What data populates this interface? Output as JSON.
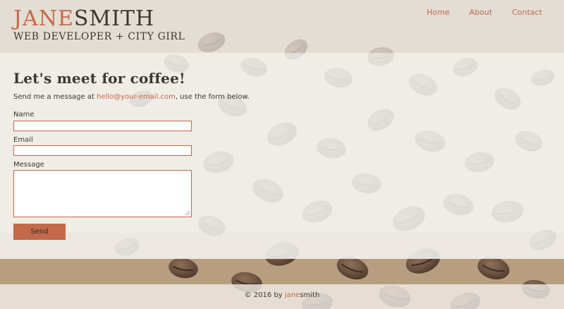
{
  "brand": {
    "first_name": "JANE",
    "last_name": "SMITH",
    "tagline": "WEB DEVELOPER + CITY GIRL",
    "accent_color": "#c4694a"
  },
  "nav": {
    "items": [
      {
        "label": "Home"
      },
      {
        "label": "About"
      },
      {
        "label": "Contact"
      }
    ]
  },
  "contact": {
    "heading": "Let's meet for coffee!",
    "intro_prefix": "Send me a message at ",
    "email": "hello@your-email.com",
    "intro_suffix": ", use the form below.",
    "name_label": "Name",
    "email_label": "Email",
    "message_label": "Message",
    "name_value": "",
    "email_value": "",
    "message_value": "",
    "send_label": "Send"
  },
  "footer": {
    "prefix": "© 2016 by ",
    "first": "jane",
    "last": "smith"
  },
  "background": {
    "icon": "coffee-beans-photo"
  }
}
